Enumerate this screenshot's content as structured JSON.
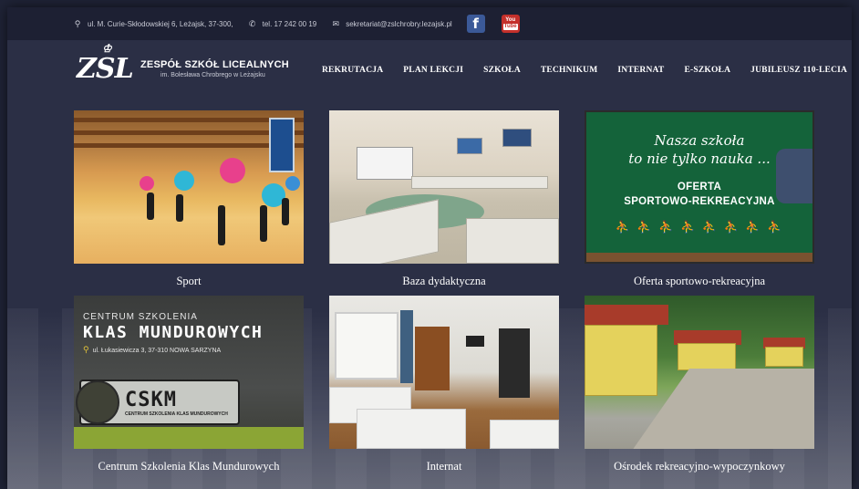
{
  "topbar": {
    "address": "ul. M. Curie-Skłodowskiej 6, Leżajsk, 37-300,",
    "phone": "tel. 17 242 00 19",
    "email": "sekretariat@zslchrobry.lezajsk.pl",
    "icons": {
      "address": "map-pin-icon",
      "phone": "phone-icon",
      "email": "envelope-icon",
      "facebook": "facebook-icon",
      "youtube": "youtube-icon"
    },
    "youtube_you": "You",
    "youtube_tube": "Tube"
  },
  "logo": {
    "mark": "ZSL",
    "title": "ZESPÓŁ SZKÓŁ LICEALNYCH",
    "subtitle": "im. Bolesława Chrobrego w Leżajsku"
  },
  "nav": [
    {
      "label": "REKRUTACJA"
    },
    {
      "label": "PLAN LEKCJI"
    },
    {
      "label": "SZKOŁA"
    },
    {
      "label": "TECHNIKUM"
    },
    {
      "label": "INTERNAT"
    },
    {
      "label": "E-SZKOŁA"
    },
    {
      "label": "JUBILEUSZ 110-LECIA"
    }
  ],
  "tiles": [
    {
      "caption": "Sport"
    },
    {
      "caption": "Baza dydaktyczna"
    },
    {
      "caption": "Oferta sportowo-rekreacyjna",
      "chalk_line1": "Nasza szkoła",
      "chalk_line2": "to nie tylko nauka ...",
      "offer_line1": "OFERTA",
      "offer_line2": "SPORTOWO-REKREACYJNA"
    },
    {
      "caption": "Centrum Szkolenia Klas Mundurowych",
      "line1": "CENTRUM SZKOLENIA",
      "line2": "KLAS MUNDUROWYCH",
      "line3": "ul. Łukasiewicza 3, 37-310 NOWA SARZYNA",
      "badge_big": "CSKM",
      "badge_small": "CENTRUM SZKOLENIA KLAS MUNDUROWYCH"
    },
    {
      "caption": "Internat"
    },
    {
      "caption": "Ośrodek rekreacyjno-wypoczynkowy"
    }
  ],
  "colors": {
    "topbar_bg": "#1d2033",
    "page_bg": "#2b2f45",
    "chalkboard": "#14633a",
    "facebook": "#3b5998",
    "youtube": "#c4302b"
  }
}
